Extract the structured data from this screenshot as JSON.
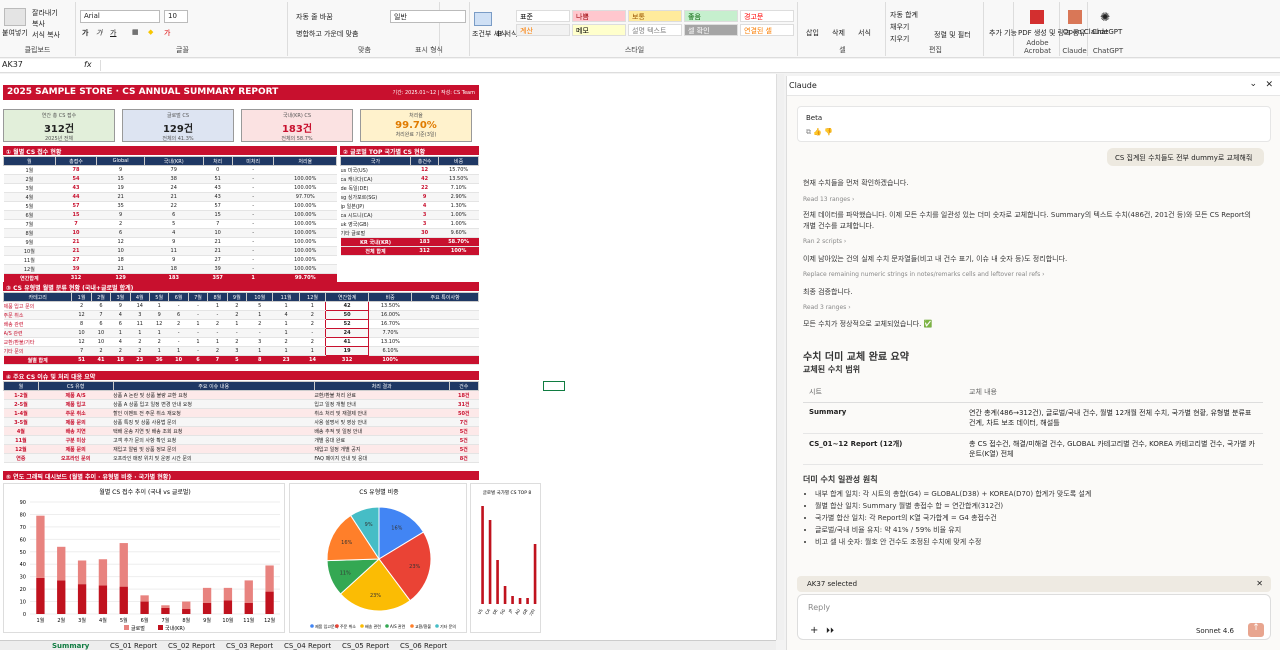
{
  "ribbon": {
    "clipboard": {
      "paste": "붙여넣기",
      "cut": "잘라내기",
      "copy": "복사",
      "format_painter": "서식 복사",
      "label": "클립보드"
    },
    "font": {
      "name": "Arial",
      "size": "10",
      "label": "글꼴"
    },
    "align": {
      "wrap": "자동 줄 바꿈",
      "merge": "병합하고 가운데 맞춤",
      "label": "맞춤"
    },
    "number": {
      "format": "일반",
      "label": "표시 형식"
    },
    "styles": {
      "cond": "조건부 서식",
      "table": "표 서식",
      "cells": [
        {
          "text": "표준",
          "bg": "#ffffff",
          "fg": "#000000"
        },
        {
          "text": "나쁨",
          "bg": "#ffc7ce",
          "fg": "#9c0006"
        },
        {
          "text": "보통",
          "bg": "#ffeb9c",
          "fg": "#9c5700"
        },
        {
          "text": "좋음",
          "bg": "#c6efce",
          "fg": "#006100"
        },
        {
          "text": "경고문",
          "bg": "#ffffff",
          "fg": "#ff0000"
        },
        {
          "text": "계산",
          "bg": "#f2f2f2",
          "fg": "#fa7d00"
        },
        {
          "text": "메모",
          "bg": "#ffffcc",
          "fg": "#000000"
        },
        {
          "text": "설명 텍스트",
          "bg": "#ffffff",
          "fg": "#7f7f7f"
        },
        {
          "text": "셀 확인",
          "bg": "#a5a5a5",
          "fg": "#ffffff"
        },
        {
          "text": "연결된 셀",
          "bg": "#ffffff",
          "fg": "#fa7d00"
        }
      ],
      "label": "스타일"
    },
    "cells": {
      "insert": "삽입",
      "delete": "삭제",
      "format": "서식",
      "label": "셀"
    },
    "editing": {
      "autosum": "자동 합계",
      "fill": "채우기",
      "clear": "지우기",
      "sort": "정렬 및 필터",
      "find": "찾기 및 선택",
      "label": "편집"
    },
    "addins": {
      "addin": "추가 기능",
      "label": "추가 기능"
    },
    "pdf": {
      "btn": "PDF 생성 및 링크 공유",
      "label": "Adobe Acrobat"
    },
    "claude": {
      "btn": "Open Claude",
      "label": "Claude"
    },
    "chatgpt": {
      "btn": "ChatGPT",
      "label": "ChatGPT"
    }
  },
  "formula_bar": {
    "namebox": "AK37",
    "fx": "fx"
  },
  "sheet": {
    "title": "2025 SAMPLE STORE · CS ANNUAL SUMMARY REPORT",
    "subtitle": "기간: 2025.01~12 | 작성: CS Team",
    "kpis": [
      {
        "title": "연간 총 CS 접수",
        "value": "312건",
        "sub": "2025년 전체",
        "bg": "#e2efda",
        "fg": "#222"
      },
      {
        "title": "글로벌 CS",
        "value": "129건",
        "sub": "전체의 41.3%",
        "bg": "#dde4f2",
        "fg": "#222"
      },
      {
        "title": "국내(KR) CS",
        "value": "183건",
        "sub": "전체의 58.7%",
        "bg": "#fbe2e2",
        "fg": "#c8102e"
      },
      {
        "title": "처리율",
        "value": "99.70%",
        "sub": "처리완료 기준(3일)",
        "bg": "#fff2cc",
        "fg": "#e07b00"
      }
    ],
    "monthly": {
      "head": "① 월별 CS 접수 현황",
      "cols": [
        "월",
        "총접수",
        "Global",
        "국내(KR)",
        "처리",
        "미처리",
        "처리율"
      ],
      "rows": [
        [
          "1월",
          "78",
          "9",
          "79",
          "0",
          "-",
          ""
        ],
        [
          "2월",
          "54",
          "15",
          "38",
          "51",
          "-",
          "100.00%"
        ],
        [
          "3월",
          "43",
          "19",
          "24",
          "43",
          "-",
          "100.00%"
        ],
        [
          "4월",
          "44",
          "21",
          "21",
          "43",
          "-",
          "97.70%"
        ],
        [
          "5월",
          "57",
          "35",
          "22",
          "57",
          "-",
          "100.00%"
        ],
        [
          "6월",
          "15",
          "9",
          "6",
          "15",
          "-",
          "100.00%"
        ],
        [
          "7월",
          "7",
          "2",
          "5",
          "7",
          "-",
          "100.00%"
        ],
        [
          "8월",
          "10",
          "6",
          "4",
          "10",
          "-",
          "100.00%"
        ],
        [
          "9월",
          "21",
          "12",
          "9",
          "21",
          "-",
          "100.00%"
        ],
        [
          "10월",
          "21",
          "10",
          "11",
          "21",
          "-",
          "100.00%"
        ],
        [
          "11월",
          "27",
          "18",
          "9",
          "27",
          "-",
          "100.00%"
        ],
        [
          "12월",
          "39",
          "21",
          "18",
          "39",
          "-",
          "100.00%"
        ]
      ],
      "total": [
        "연간합계",
        "312",
        "129",
        "183",
        "357",
        "1",
        "99.70%"
      ]
    },
    "country": {
      "head": "② 글로벌 TOP 국가별 CS 현황",
      "cols": [
        "국가",
        "총건수",
        "비중"
      ],
      "rows": [
        [
          "us 미국(US)",
          "12",
          "15.70%"
        ],
        [
          "ca 캐나다(CA)",
          "42",
          "13.50%"
        ],
        [
          "de 독일(DE)",
          "22",
          "7.10%"
        ],
        [
          "sg 싱가포르(SG)",
          "9",
          "2.90%"
        ],
        [
          "jp 일본(JP)",
          "4",
          "1.30%"
        ],
        [
          "ca 시드니(CA)",
          "3",
          "1.00%"
        ],
        [
          "uk 영국(GB)",
          "3",
          "1.00%"
        ],
        [
          "기타 글로벌",
          "30",
          "9.60%"
        ]
      ],
      "kr": [
        "KR 국내(KR)",
        "183",
        "58.70%"
      ],
      "total": [
        "전체 합계",
        "312",
        "100%"
      ]
    },
    "types": {
      "head": "③ CS 유형별 월별 분류 현황 (국내+글로벌 합계)",
      "cols": [
        "카테고리",
        "1월",
        "2월",
        "3월",
        "4월",
        "5월",
        "6월",
        "7월",
        "8월",
        "9월",
        "10월",
        "11월",
        "12월",
        "연간합계",
        "비중",
        "주요 특이사항"
      ],
      "rows": [
        [
          "제품 입고 문의",
          "2",
          "6",
          "9",
          "14",
          "1",
          "-",
          "-",
          "1",
          "2",
          "5",
          "1",
          "1",
          "42",
          "13.50%"
        ],
        [
          "주문 취소",
          "12",
          "7",
          "4",
          "3",
          "9",
          "6",
          "-",
          "-",
          "2",
          "1",
          "4",
          "2",
          "50",
          "16.00%"
        ],
        [
          "배송 관련",
          "8",
          "6",
          "6",
          "11",
          "12",
          "2",
          "1",
          "2",
          "1",
          "2",
          "1",
          "2",
          "52",
          "16.70%"
        ],
        [
          "A/S 관련",
          "10",
          "10",
          "1",
          "1",
          "1",
          "-",
          "-",
          "-",
          "-",
          "-",
          "1",
          "-",
          "24",
          "7.70%"
        ],
        [
          "교환/환불/기타",
          "12",
          "10",
          "4",
          "2",
          "2",
          "-",
          "1",
          "1",
          "2",
          "3",
          "2",
          "2",
          "41",
          "13.10%"
        ],
        [
          "기타 문의",
          "7",
          "2",
          "2",
          "2",
          "1",
          "1",
          "-",
          "2",
          "3",
          "1",
          "1",
          "1",
          "19",
          "6.10%"
        ]
      ],
      "total": [
        "월별 합계",
        "51",
        "41",
        "18",
        "23",
        "36",
        "10",
        "6",
        "7",
        "5",
        "8",
        "23",
        "14",
        "312",
        "100%"
      ]
    },
    "issues": {
      "head": "④ 주요 CS 이슈 및 처리 대응 요약",
      "cols": [
        "월",
        "CS 유형",
        "주요 이슈 내용",
        "처리 결과",
        "건수"
      ],
      "rows": [
        [
          "1-2월",
          "제품 A/S",
          "상품 A 논란 및 상품 불량 교환 요청",
          "교환/환불 처리 완료",
          "18건"
        ],
        [
          "2-5월",
          "제품 입고",
          "상품 A 상품 입고 일정 변경 안내 요청",
          "입고 일정 개별 안내",
          "31건"
        ],
        [
          "1-4월",
          "주문 취소",
          "할인 이벤트 전 주문 취소 재요청",
          "취소 처리 및 재결제 안내",
          "50건"
        ],
        [
          "3-5월",
          "제품 문의",
          "상품 특징 및 상품 사용법 문의",
          "사용 설명서 및 영상 안내",
          "7건"
        ],
        [
          "4월",
          "배송 지연",
          "택배 운송 지연 및 배송 조회 요청",
          "배송 추적 및 일정 안내",
          "5건"
        ],
        [
          "11월",
          "구분 미상",
          "고객 추가 문의 사항 확인 요청",
          "개별 응대 완료",
          "5건"
        ],
        [
          "12월",
          "제품 문의",
          "재입고 알림 및 상품 정보 문의",
          "재입고 일정 개별 공지",
          "5건"
        ],
        [
          "연중",
          "오프라인 문의",
          "오프라인 매장 위치 및 운영 시간 문의",
          "FAQ 페이지 안내 및 응대",
          "8건"
        ]
      ]
    },
    "dash_head": "⑤ 연도 그래픽 대시보드 (월별 추이 · 유형별 비중 · 국가별 현황)"
  },
  "chart_data": [
    {
      "type": "bar",
      "title": "월별 CS 접수 추이 (국내 vs 글로벌)",
      "categories": [
        "1월",
        "2월",
        "3월",
        "4월",
        "5월",
        "6월",
        "7월",
        "8월",
        "9월",
        "10월",
        "11월",
        "12월"
      ],
      "series": [
        {
          "name": "글로벌",
          "values": [
            50,
            27,
            19,
            21,
            35,
            5,
            2,
            6,
            12,
            10,
            18,
            21
          ],
          "color": "#e8837f"
        },
        {
          "name": "국내(KR)",
          "values": [
            29,
            27,
            24,
            23,
            22,
            10,
            5,
            4,
            9,
            11,
            9,
            18
          ],
          "color": "#c0121e"
        }
      ],
      "ylim": [
        0,
        90
      ],
      "yticks": [
        0,
        10,
        20,
        30,
        40,
        50,
        60,
        70,
        80,
        90
      ]
    },
    {
      "type": "pie",
      "title": "CS 유형별 비중",
      "labels": [
        "제품 입고문의",
        "주문 취소",
        "배송 관련",
        "A/S 관련",
        "교환/환불",
        "기타 문의"
      ],
      "values": [
        16,
        23,
        23,
        11,
        16,
        9
      ],
      "colors": [
        "#4285f4",
        "#ea4335",
        "#fbbc04",
        "#34a853",
        "#ff7f2a",
        "#46bdc6"
      ]
    },
    {
      "type": "bar",
      "title": "글로벌 국가별 CS TOP 8",
      "categories": [
        "US",
        "CA",
        "DE",
        "SG",
        "JP",
        "AU",
        "GB",
        "기타"
      ],
      "values": [
        49,
        42,
        22,
        9,
        4,
        3,
        3,
        30
      ],
      "color": "#c0121e",
      "ylim": [
        0,
        50
      ]
    }
  ],
  "tabs": [
    "Summary",
    "CS_01 Report",
    "CS_02 Report",
    "CS_03 Report",
    "CS_04 Report",
    "CS_05 Report",
    "CS_06 Report"
  ],
  "panel": {
    "title": "Claude",
    "beta": "Beta",
    "user_msg": "CS 집계된 수치들도 전부 dummy로 교체해줘",
    "lines": [
      "현재 수치들을 먼저 확인하겠습니다.",
      "Read 13 ranges",
      "전체 데이터를 파악했습니다. 이제 모든 수치를 일관성 있는 더미 숫자로 교체합니다. Summary의 텍스트 수치(486건, 201건 등)와 모든 CS Report의",
      "개별 건수를 교체합니다.",
      "Ran 2 scripts",
      "이제 남아있는 건의 실제 수치 문자열들(비고 내 건수 표기, 이슈 내 숫자 등)도 정리합니다.",
      "Replace remaining numeric strings in notes/remarks cells and leftover real refs",
      "최종 검증합니다.",
      "Read 3 ranges",
      "모든 수치가 정상적으로 교체되었습니다. ✅"
    ],
    "h1": "수치 더미 교체 완료 요약",
    "h2": "교체된 수치 범위",
    "table": {
      "cols": [
        "시트",
        "교체 내용"
      ],
      "rows": [
        [
          "Summary",
          "연간 총계(486→312건), 글로벌/국내 건수, 월별 12개월 전체 수치, 국가별 현황, 유형별 분류표 건계, 차트 보조 데이터, 해설틀"
        ],
        [
          "CS_01~12 Report (12개)",
          "총 CS 접수건, 해결/미해결 건수, GLOBAL 카테고리별 건수, KOREA 카테고리별 건수, 국가별 카운트(K열) 전체"
        ]
      ]
    },
    "h3": "더미 수치 일관성 원칙",
    "bullets": [
      "내부 합계 일치: 각 시트의 총합(G4) = GLOBAL(D38) + KOREA(D70) 합계가 맞도록 설계",
      "월별 합산 일치: Summary 월별 총접수 합 = 연간합계(312건)",
      "국가별 합산 일치: 각 Report의 K열 국가합계 = G4 총접수건",
      "글로벌/국내 비율 유지: 약 41% / 59% 비율 유지",
      "비고 셀 내 숫자: 월호 안 건수도 조정된 수치에 맞게 수정"
    ],
    "selected": "AK37 selected",
    "reply_placeholder": "Reply",
    "model": "Sonnet 4.6"
  }
}
